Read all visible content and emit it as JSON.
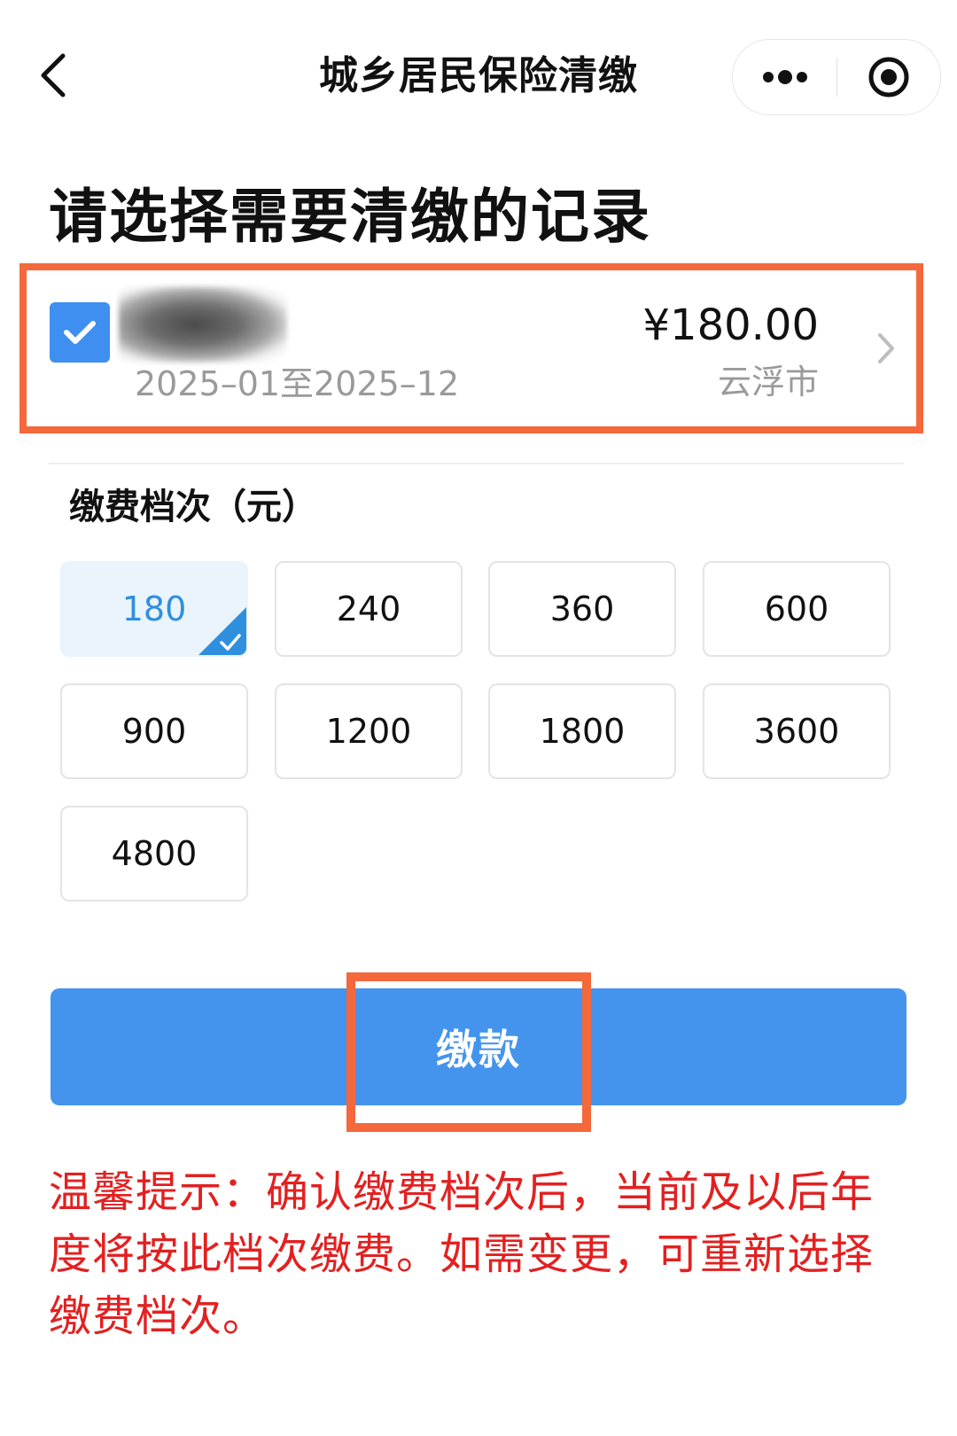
{
  "navbar": {
    "title": "城乡居民保险清缴"
  },
  "heading": "请选择需要清缴的记录",
  "record": {
    "checked": true,
    "period": "2025–01至2025–12",
    "amount": "¥180.00",
    "city": "云浮市"
  },
  "tier": {
    "title": "缴费档次（元）",
    "selected": "180",
    "options": [
      "180",
      "240",
      "360",
      "600",
      "900",
      "1200",
      "1800",
      "3600",
      "4800"
    ]
  },
  "pay_button": {
    "label": "缴款"
  },
  "notice": "温馨提示：确认缴费档次后，当前及以后年度将按此档次缴费。如需变更，可重新选择缴费档次。",
  "colors": {
    "accent": "#4494ee",
    "checkbox": "#3f8ff0",
    "selected_tier_bg": "#eaf4fd",
    "selected_tier_text": "#2f8fdf",
    "highlight_frame": "#f4683c",
    "notice_text": "#e32020"
  },
  "icons": {
    "back": "chevron-left-icon",
    "more": "more-dots-icon",
    "close": "capsule-close-icon",
    "checkbox": "check-icon",
    "row_arrow": "chevron-right-icon",
    "tier_selected_mark": "corner-check-icon"
  }
}
